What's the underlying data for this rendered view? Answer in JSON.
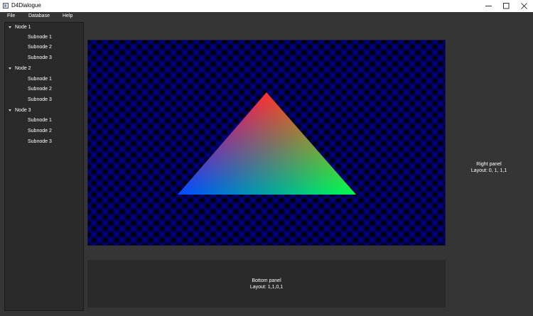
{
  "window": {
    "title": "D4Dialogue"
  },
  "menu": {
    "file": "File",
    "database": "Database",
    "help": "Help"
  },
  "tree": {
    "nodes": [
      {
        "label": "Node 1",
        "children": [
          "Subnode 1",
          "Subnode 2",
          "Subnode 3"
        ]
      },
      {
        "label": "Node 2",
        "children": [
          "Subnode 1",
          "Subnode 2",
          "Subnode 3"
        ]
      },
      {
        "label": "Node 3",
        "children": [
          "Subnode 1",
          "Subnode 2",
          "Subnode 3"
        ]
      }
    ]
  },
  "viewport": {
    "background_color": "#0000e6",
    "triangle_colors": [
      "#ff0000",
      "#0000ff",
      "#00ff00"
    ]
  },
  "right_panel": {
    "title": "Right panel",
    "layout": "Layout: 0, 1, 1,1"
  },
  "bottom_panel": {
    "title": "Bottom panel",
    "layout": "Layout: 1,1,0,1"
  },
  "colors": {
    "background": "#353535",
    "panel": "#2a2a2a",
    "text": "#ffffff"
  }
}
